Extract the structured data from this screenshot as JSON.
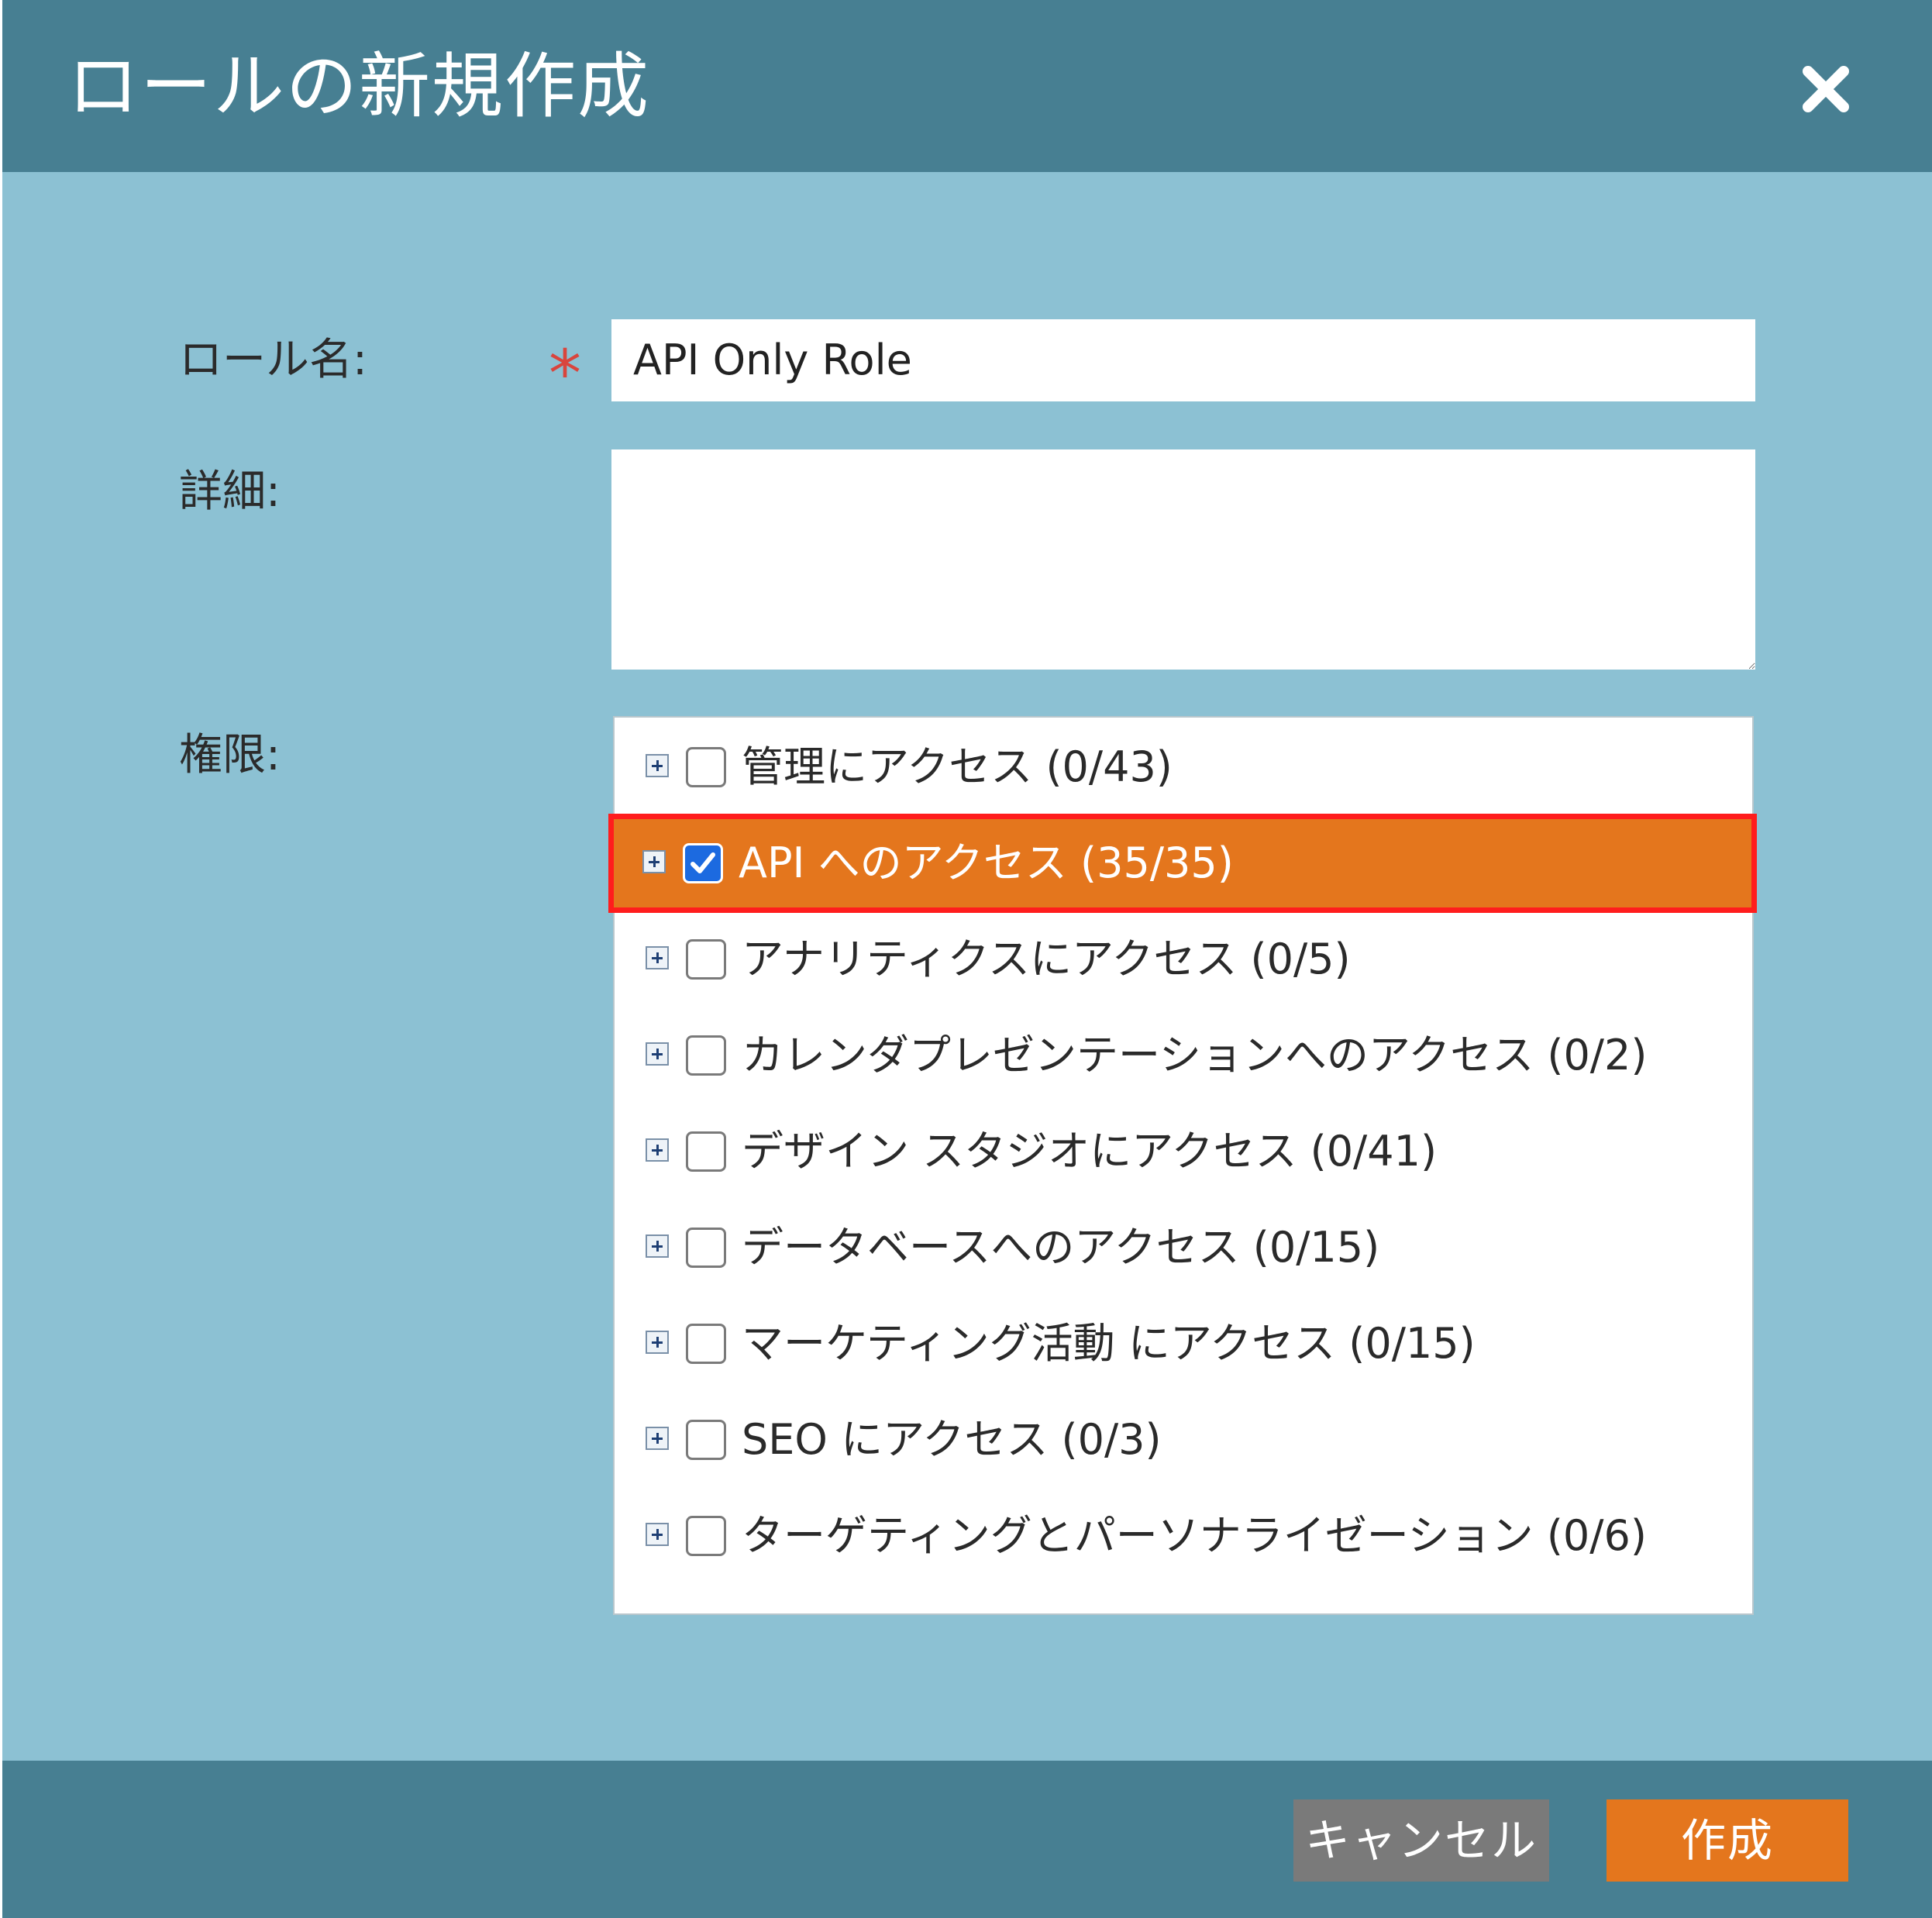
{
  "dialog": {
    "title": "ロールの新規作成",
    "close_icon": "close-icon"
  },
  "form": {
    "role_name_label": "ロール名:",
    "required_mark": "*",
    "role_name_value": "API Only Role",
    "details_label": "詳細:",
    "details_value": "",
    "permissions_label": "権限:"
  },
  "permissions": [
    {
      "label": "管理にアクセス (0/43)",
      "checked": false
    },
    {
      "label": "API へのアクセス (35/35)",
      "checked": true,
      "highlighted": true
    },
    {
      "label": "アナリティクスにアクセス (0/5)",
      "checked": false
    },
    {
      "label": "カレンダプレゼンテーションへのアクセス (0/2)",
      "checked": false
    },
    {
      "label": "デザイン スタジオにアクセス (0/41)",
      "checked": false
    },
    {
      "label": "データベースへのアクセス (0/15)",
      "checked": false
    },
    {
      "label": "マーケティング活動 にアクセス (0/15)",
      "checked": false
    },
    {
      "label": "SEO にアクセス (0/3)",
      "checked": false
    },
    {
      "label": "ターゲティングとパーソナライゼーション (0/6)",
      "checked": false
    }
  ],
  "footer": {
    "cancel_label": "キャンセル",
    "create_label": "作成"
  },
  "colors": {
    "header_bg": "#477f92",
    "body_bg": "#8cc1d3",
    "accent_orange": "#e4761d",
    "highlight_border": "#ff1d1d",
    "cancel_gray": "#7a7a7a"
  }
}
